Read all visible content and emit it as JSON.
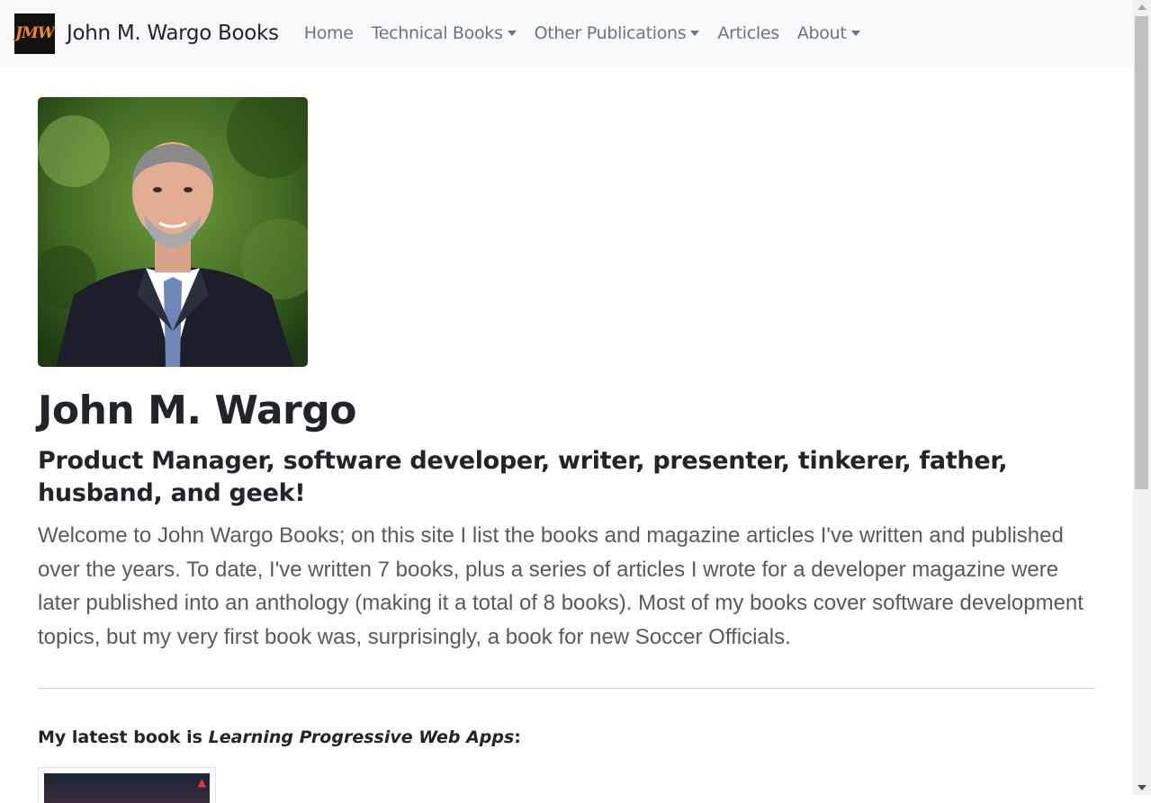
{
  "navbar": {
    "brand_logo_text": "JMW",
    "brand_title": "John M. Wargo Books",
    "items": [
      {
        "label": "Home",
        "dropdown": false
      },
      {
        "label": "Technical Books",
        "dropdown": true
      },
      {
        "label": "Other Publications",
        "dropdown": true
      },
      {
        "label": "Articles",
        "dropdown": false
      },
      {
        "label": "About",
        "dropdown": true
      }
    ]
  },
  "hero": {
    "name": "John M. Wargo",
    "tagline": "Product Manager, software developer, writer, presenter, tinkerer, father, husband, and geek!",
    "intro": "Welcome to John Wargo Books; on this site I list the books and magazine articles I've written and published over the years. To date, I've written 7 books, plus a series of articles I wrote for a developer magazine were later published into an anthology (making it a total of 8 books). Most of my books cover software development topics, but my very first book was, surprisingly, a book for new Soccer Officials."
  },
  "latest_book": {
    "prefix": "My latest book is ",
    "title": "Learning Progressive Web Apps",
    "suffix": ":"
  },
  "colors": {
    "navbar_bg": "#f8f9fa",
    "nav_link": "#6c757d",
    "text": "#212529",
    "lead_text": "#5a5a5a",
    "logo_accent": "#f08a24"
  }
}
